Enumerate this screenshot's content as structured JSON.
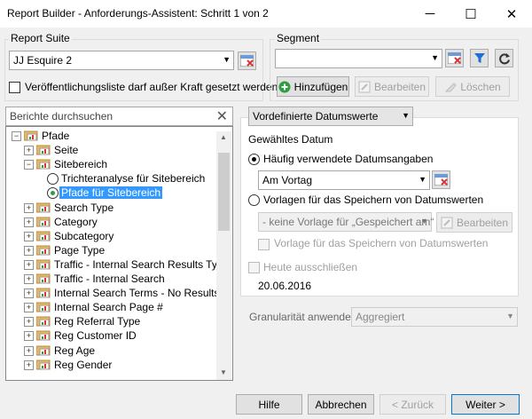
{
  "window": {
    "title": "Report Builder - Anforderungs-Assistent: Schritt 1 von 2"
  },
  "report_suite": {
    "label": "Report Suite",
    "value": "JJ Esquire 2",
    "checkbox_label": "Veröffentlichungsliste darf außer Kraft gesetzt werden"
  },
  "segment": {
    "label": "Segment",
    "value": "",
    "add_label": "Hinzufügen",
    "edit_label": "Bearbeiten",
    "delete_label": "Löschen"
  },
  "search": {
    "placeholder": "Berichte durchsuchen"
  },
  "tree": {
    "root": "Pfade",
    "items": [
      {
        "label": "Seite"
      },
      {
        "label": "Sitebereich"
      },
      {
        "label": "Trichteranalyse für Sitebereich"
      },
      {
        "label": "Pfade für Sitebereich"
      },
      {
        "label": "Search Type"
      },
      {
        "label": "Category"
      },
      {
        "label": "Subcategory"
      },
      {
        "label": "Page Type"
      },
      {
        "label": "Traffic - Internal Search Results Type"
      },
      {
        "label": "Traffic - Internal Search"
      },
      {
        "label": "Internal Search Terms - No Results"
      },
      {
        "label": "Internal Search Page #"
      },
      {
        "label": "Reg Referral Type"
      },
      {
        "label": "Reg Customer ID"
      },
      {
        "label": "Reg Age"
      },
      {
        "label": "Reg Gender"
      }
    ]
  },
  "date": {
    "mode": "Vordefinierte Datumswerte",
    "selected_label": "Gewähltes Datum",
    "common_label": "Häufig verwendete Datumsangaben",
    "common_value": "Am Vortag",
    "templates_label": "Vorlagen für das Speichern von Datumswerten",
    "templates_value": "- keine Vorlage für „Gespeichert am“",
    "templates_edit": "Bearbeiten",
    "templates_check": "Vorlage für das Speichern von Datumswerten",
    "exclude_today": "Heute ausschließen",
    "date_value": "20.06.2016"
  },
  "granularity": {
    "label": "Granularität anwenden",
    "value": "Aggregiert"
  },
  "footer": {
    "help": "Hilfe",
    "cancel": "Abbrechen",
    "back": "< Zurück",
    "next": "Weiter >"
  },
  "colors": {
    "selection": "#3399ff",
    "accent": "#1c6fd3",
    "icon_folder": "#e8b866",
    "icon_green": "#2e9e3e"
  }
}
